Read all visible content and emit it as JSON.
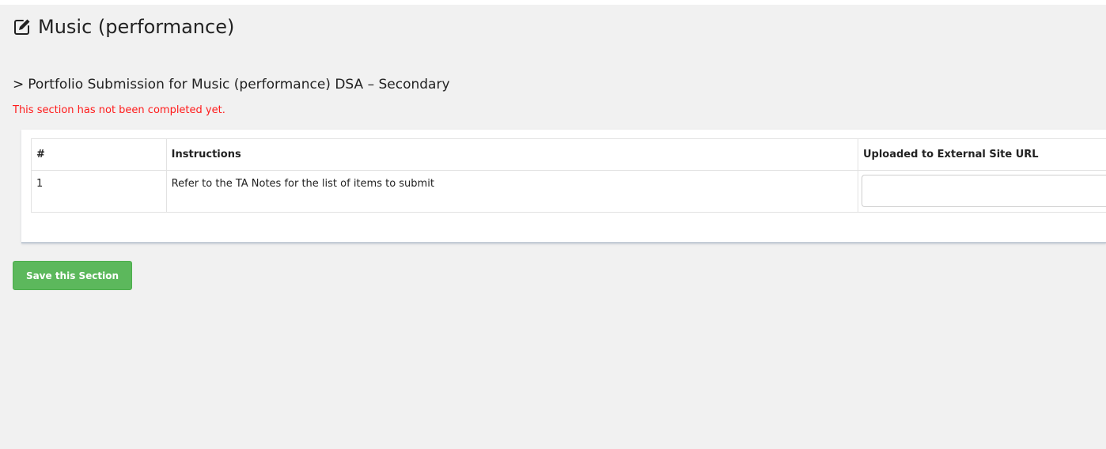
{
  "page": {
    "title": "Music (performance)",
    "title_icon": "edit-icon"
  },
  "section": {
    "chevron": ">",
    "heading": "Portfolio Submission for Music (performance) DSA – Secondary",
    "status_text": "This section has not been completed yet.",
    "status_color": "#ff1a1a"
  },
  "table": {
    "headers": {
      "number": "#",
      "instructions": "Instructions",
      "url": "Uploaded to External Site URL"
    },
    "rows": [
      {
        "number": "1",
        "instructions": "Refer to the TA Notes for the list of items to submit",
        "url_value": ""
      }
    ]
  },
  "actions": {
    "save_label": "Save this Section",
    "save_color": "#5cb85c"
  }
}
